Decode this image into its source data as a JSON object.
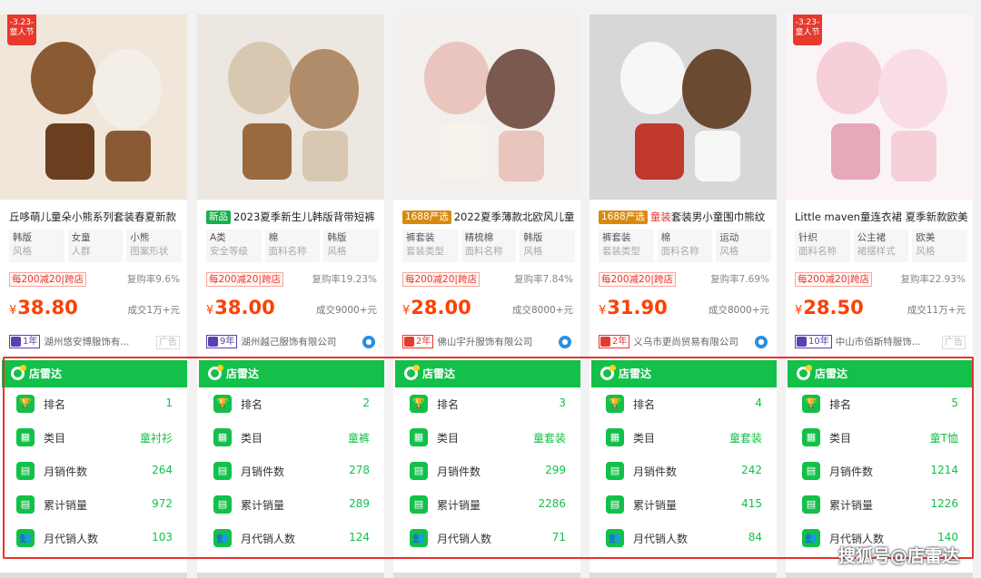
{
  "products": [
    {
      "badge": "-3.23-\n童人节",
      "title_tag": "",
      "title_tag_type": "",
      "title_prefix": "",
      "title": "丘哆萌儿童朵小熊系列套装春夏新款",
      "attrs": [
        {
          "v": "韩版",
          "k": "风格"
        },
        {
          "v": "女童",
          "k": "人群"
        },
        {
          "v": "小熊",
          "k": "图案形状"
        }
      ],
      "coupon": "每200减20|跨店",
      "repurchase": "复购率9.6%",
      "price": "38.80",
      "deal": "成交1万+元",
      "years": "1年",
      "shop": "湖州悠安博服饰有...",
      "ad": "广告",
      "image_theme": "brown"
    },
    {
      "badge": "",
      "title_tag": "新品",
      "title_tag_type": "new",
      "title_prefix": "",
      "title": "2023夏季新生儿韩版背带短裤",
      "attrs": [
        {
          "v": "A类",
          "k": "安全等级"
        },
        {
          "v": "棉",
          "k": "面料名称"
        },
        {
          "v": "韩版",
          "k": "风格"
        }
      ],
      "coupon": "每200减20|跨店",
      "repurchase": "复购率19.23%",
      "price": "38.00",
      "deal": "成交9000+元",
      "years": "9年",
      "shop": "湖州越己服饰有限公司",
      "ad": "",
      "image_theme": "beige"
    },
    {
      "badge": "",
      "title_tag": "1688严选",
      "title_tag_type": "yx",
      "title_prefix": "",
      "title": "2022夏季薄款北欧风儿童",
      "attrs": [
        {
          "v": "裤套装",
          "k": "套装类型"
        },
        {
          "v": "精梳棉",
          "k": "面料名称"
        },
        {
          "v": "韩版",
          "k": "风格"
        }
      ],
      "coupon": "每200减20|跨店",
      "repurchase": "复购率7.84%",
      "price": "28.00",
      "deal": "成交8000+元",
      "years": "2年",
      "shop": "佛山宇升服饰有限公司",
      "ad": "",
      "image_theme": "pinkbrown"
    },
    {
      "badge": "",
      "title_tag": "1688严选",
      "title_tag_type": "yx",
      "title_prefix": "童装",
      "title": "套装男小童围巾熊纹",
      "attrs": [
        {
          "v": "裤套装",
          "k": "套装类型"
        },
        {
          "v": "棉",
          "k": "面料名称"
        },
        {
          "v": "运动",
          "k": "风格"
        }
      ],
      "coupon": "每200减20|跨店",
      "repurchase": "复购率7.69%",
      "price": "31.90",
      "deal": "成交8000+元",
      "years": "2年",
      "shop": "义乌市更尚贸易有限公司",
      "ad": "",
      "image_theme": "white"
    },
    {
      "badge": "-3.23-\n童人节",
      "title_tag": "",
      "title_tag_type": "",
      "title_prefix": "",
      "title": "Little maven童连衣裙 夏季新款欧美",
      "attrs": [
        {
          "v": "针织",
          "k": "面料名称"
        },
        {
          "v": "公主裙",
          "k": "裙摆样式"
        },
        {
          "v": "欧美",
          "k": "风格"
        }
      ],
      "coupon": "每200减20|跨店",
      "repurchase": "复购率22.93%",
      "price": "28.50",
      "deal": "成交11万+元",
      "years": "10年",
      "shop": "中山市佰斯特服饰...",
      "ad": "广告",
      "image_theme": "pink"
    }
  ],
  "radar": {
    "title": "店雷达",
    "labels": {
      "rank": "排名",
      "category": "类目",
      "monthly_items": "月销件数",
      "cumulative": "累计销量",
      "monthly_agents": "月代销人数"
    },
    "cards": [
      {
        "rank": "1",
        "category": "童衬衫",
        "monthly_items": "264",
        "cumulative": "972",
        "monthly_agents": "103"
      },
      {
        "rank": "2",
        "category": "童裤",
        "monthly_items": "278",
        "cumulative": "289",
        "monthly_agents": "124"
      },
      {
        "rank": "3",
        "category": "童套装",
        "monthly_items": "299",
        "cumulative": "2286",
        "monthly_agents": "71"
      },
      {
        "rank": "4",
        "category": "童套装",
        "monthly_items": "242",
        "cumulative": "415",
        "monthly_agents": "84"
      },
      {
        "rank": "5",
        "category": "童T恤",
        "monthly_items": "1214",
        "cumulative": "1226",
        "monthly_agents": "140"
      }
    ]
  },
  "currency": "¥",
  "watermark": "搜狐号@店雷达",
  "colors": {
    "radar_green": "#12c04a",
    "price_orange": "#ff4000",
    "frame_red": "#e8322d"
  }
}
